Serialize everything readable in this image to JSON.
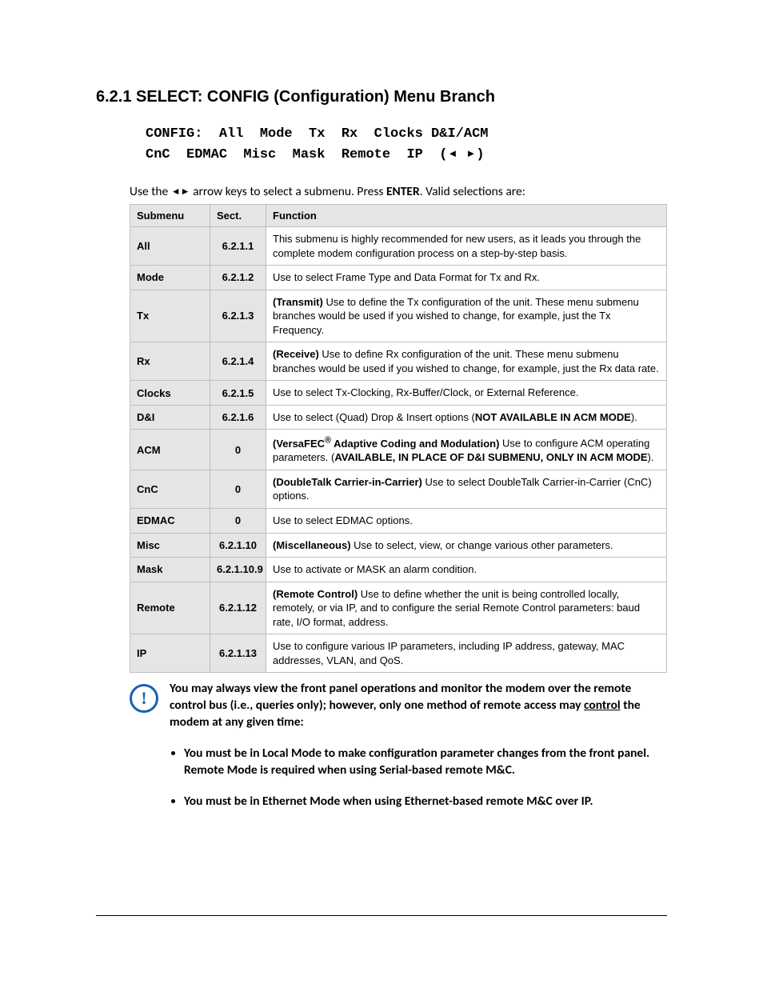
{
  "heading": "6.2.1  SELECT: CONFIG (Configuration) Menu Branch",
  "code_line1": "CONFIG:  All  Mode  Tx  Rx  Clocks D&I/ACM",
  "code_line2_pre": "CnC  EDMAC  Misc  Mask  Remote  IP  (",
  "code_line2_post": ")",
  "intro_pre": "Use the ",
  "intro_mid": " arrow keys to select a submenu. Press ",
  "intro_enter": "ENTER",
  "intro_post": ". Valid selections are:",
  "left_tri": "◄",
  "right_tri": "►",
  "table": {
    "headers": [
      "Submenu",
      "Sect.",
      "Function"
    ],
    "rows": [
      {
        "sub": "All",
        "sect": "6.2.1.1",
        "func": "This submenu is highly recommended for new users, as it leads you through the complete modem configuration process on a step-by-step basis."
      },
      {
        "sub": "Mode",
        "sect": "6.2.1.2",
        "func": "Use to select Frame Type and Data Format for Tx and Rx."
      },
      {
        "sub": "Tx",
        "sect": "6.2.1.3",
        "func": "<b>(Transmit) </b>Use to define the Tx configuration of the unit. These menu submenu branches would be used if you wished to change, for example, just the Tx Frequency."
      },
      {
        "sub": "Rx",
        "sect": "6.2.1.4",
        "func": "<b>(Receive) </b>Use to define Rx configuration of the unit. These menu submenu branches would be used if you wished to change, for example, just the Rx data rate."
      },
      {
        "sub": "Clocks",
        "sect": "6.2.1.5",
        "func": "Use to select Tx-Clocking, Rx-Buffer/Clock, or External Reference."
      },
      {
        "sub": "D&I",
        "sect": "6.2.1.6",
        "func": "Use to select (Quad) Drop & Insert options (<b>NOT AVAILABLE IN ACM MODE</b>)."
      },
      {
        "sub": "ACM",
        "sect": "0",
        "func": "<b>(VersaFEC<sup>®</sup> Adaptive Coding and Modulation) </b>Use to configure ACM operating parameters. (<b>AVAILABLE, IN PLACE OF D&I SUBMENU, ONLY IN ACM MODE</b>)."
      },
      {
        "sub": "CnC",
        "sect": "0",
        "func": "<b>(DoubleTalk Carrier-in-Carrier) </b>Use to select DoubleTalk Carrier-in-Carrier (CnC) options."
      },
      {
        "sub": "EDMAC",
        "sect": "0",
        "func": "Use to select EDMAC options."
      },
      {
        "sub": "Misc",
        "sect": "6.2.1.10",
        "func": "<b>(Miscellaneous) </b>Use to select, view, or change various other parameters."
      },
      {
        "sub": "Mask",
        "sect": "6.2.1.10.9",
        "func": "Use to activate or MASK an alarm condition."
      },
      {
        "sub": "Remote",
        "sect": "6.2.1.12",
        "func": "<b>(Remote Control) </b>Use to define whether the unit is being controlled locally, remotely, or via IP, and to configure the serial Remote Control parameters: baud rate, I/O format, address."
      },
      {
        "sub": "IP",
        "sect": "6.2.1.13",
        "func": "Use to configure various IP parameters, including IP address, gateway, MAC addresses, VLAN, and QoS."
      }
    ]
  },
  "note_html": "You may always view the front panel operations and monitor the modem over the remote control bus (i.e., queries only); however, only one method of remote access may <span class=\"underline\">control</span> the modem at any given time:",
  "bullets": [
    "You must be in Local Mode to make configuration parameter changes from the front panel. Remote Mode is required when using Serial-based remote M&C.",
    "You must be in Ethernet Mode when using Ethernet-based remote M&C over IP."
  ]
}
